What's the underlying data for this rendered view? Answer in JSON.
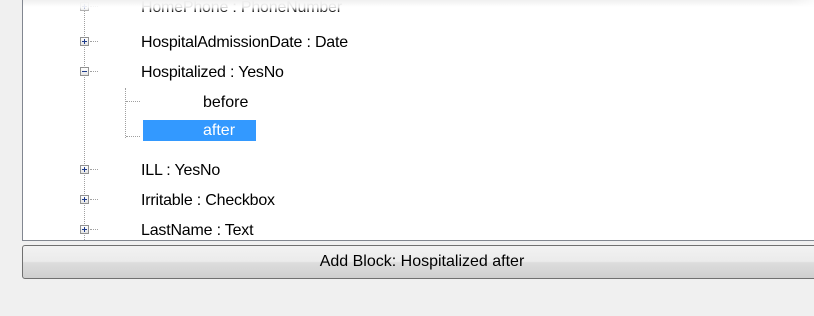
{
  "tree": {
    "items": [
      {
        "label": "HomePhone : PhoneNumber",
        "expander": "plus"
      },
      {
        "label": "HospitalAdmissionDate : Date",
        "expander": "plus"
      },
      {
        "label": "Hospitalized : YesNo",
        "expander": "minus",
        "children": [
          {
            "label": "before",
            "selected": false
          },
          {
            "label": "after",
            "selected": true
          }
        ]
      },
      {
        "label": "ILL : YesNo",
        "expander": "plus"
      },
      {
        "label": "Irritable : Checkbox",
        "expander": "plus"
      },
      {
        "label": "LastName : Text",
        "expander": "plus"
      }
    ]
  },
  "add_button": {
    "label": "Add Block: Hospitalized after"
  },
  "colors": {
    "selection": "#3399ff",
    "tree_background": "#ffffff",
    "window_background": "#f0f0f0"
  },
  "icons": {
    "plus": "plus-square-icon",
    "minus": "minus-square-icon"
  }
}
